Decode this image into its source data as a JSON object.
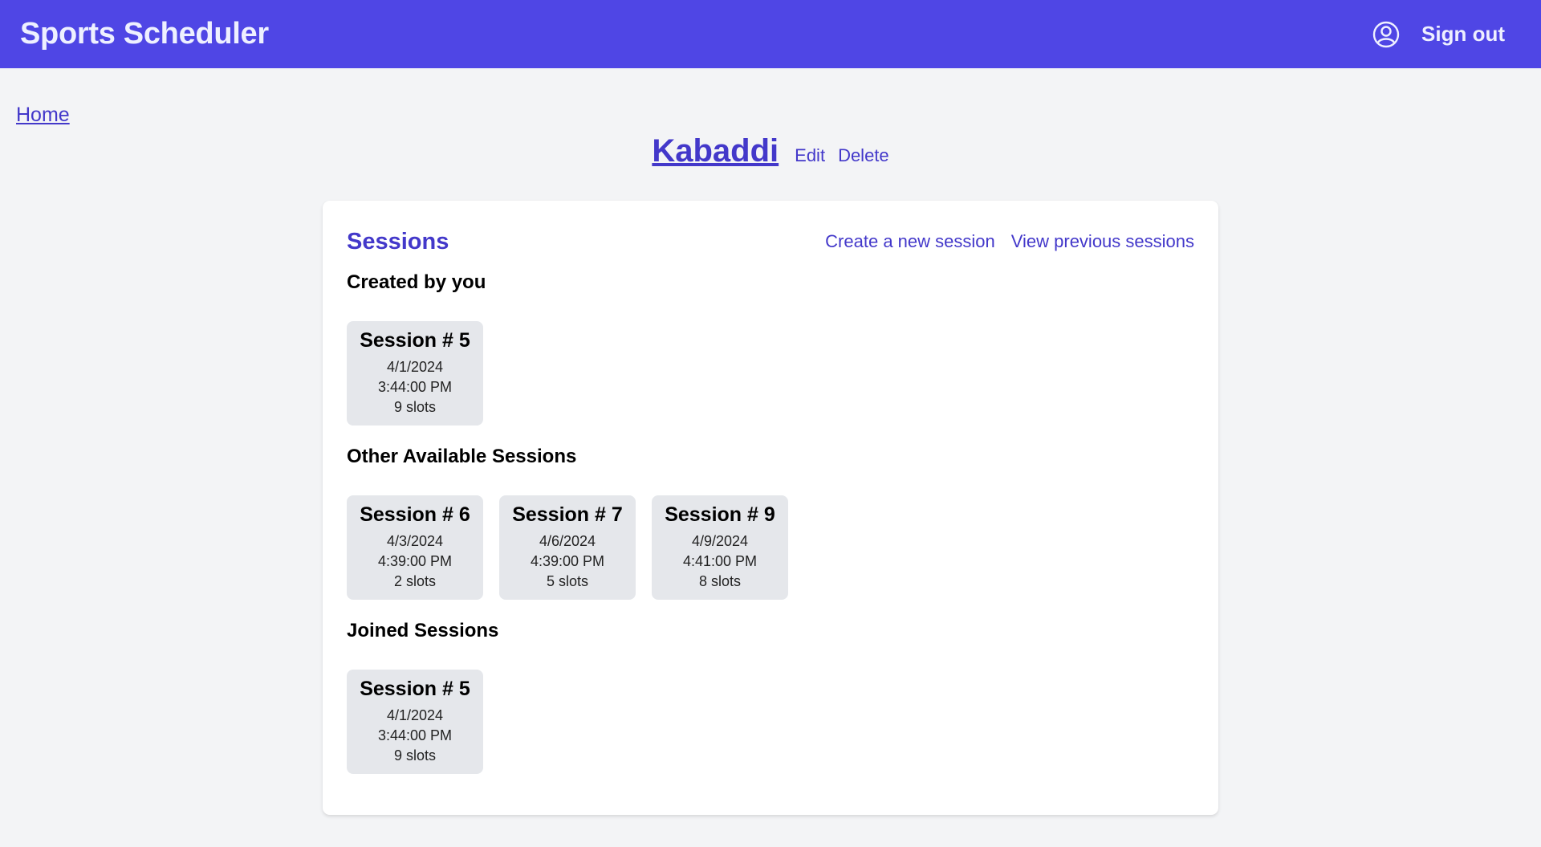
{
  "app": {
    "title": "Sports Scheduler"
  },
  "header": {
    "user_icon": "user-circle-icon",
    "signout_label": "Sign out"
  },
  "nav": {
    "home_label": "Home"
  },
  "sport": {
    "name": "Kabaddi",
    "edit_label": "Edit",
    "delete_label": "Delete"
  },
  "sessions": {
    "title": "Sessions",
    "create_label": "Create a new session",
    "previous_label": "View previous sessions",
    "created_by_you": {
      "title": "Created by you",
      "items": [
        {
          "name": "Session # 5",
          "date": "4/1/2024",
          "time": "3:44:00 PM",
          "slots": "9 slots"
        }
      ]
    },
    "other_available": {
      "title": "Other Available Sessions",
      "items": [
        {
          "name": "Session # 6",
          "date": "4/3/2024",
          "time": "4:39:00 PM",
          "slots": "2 slots"
        },
        {
          "name": "Session # 7",
          "date": "4/6/2024",
          "time": "4:39:00 PM",
          "slots": "5 slots"
        },
        {
          "name": "Session # 9",
          "date": "4/9/2024",
          "time": "4:41:00 PM",
          "slots": "8 slots"
        }
      ]
    },
    "joined": {
      "title": "Joined Sessions",
      "items": [
        {
          "name": "Session # 5",
          "date": "4/1/2024",
          "time": "3:44:00 PM",
          "slots": "9 slots"
        }
      ]
    }
  },
  "colors": {
    "accent": "#4f46e5",
    "link": "#4338ca",
    "background": "#f3f4f6",
    "tile": "#e5e7eb"
  }
}
